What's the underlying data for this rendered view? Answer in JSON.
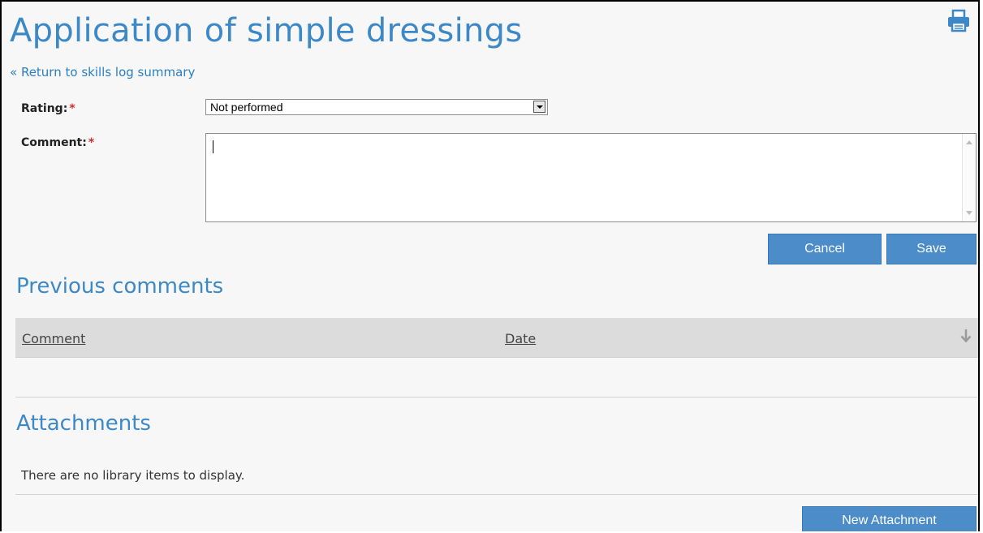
{
  "page": {
    "title": "Application of simple dressings",
    "return_link": "« Return to skills log summary",
    "print_icon": "printer-icon"
  },
  "form": {
    "rating_label": "Rating:",
    "comment_label": "Comment:",
    "required_marker": "*",
    "rating_value": "Not performed",
    "comment_value": "",
    "cancel_label": "Cancel",
    "save_label": "Save"
  },
  "previous_comments": {
    "heading": "Previous comments",
    "columns": [
      "Comment",
      "Date"
    ],
    "sort_icon": "arrow-down-icon",
    "rows": []
  },
  "attachments": {
    "heading": "Attachments",
    "empty_message": "There are no library items to display.",
    "new_button_label": "New Attachment"
  },
  "colors": {
    "accent": "#3d88c6",
    "button": "#4b8cc9",
    "required": "#d62d2d",
    "table_header": "#dcdcdc"
  }
}
